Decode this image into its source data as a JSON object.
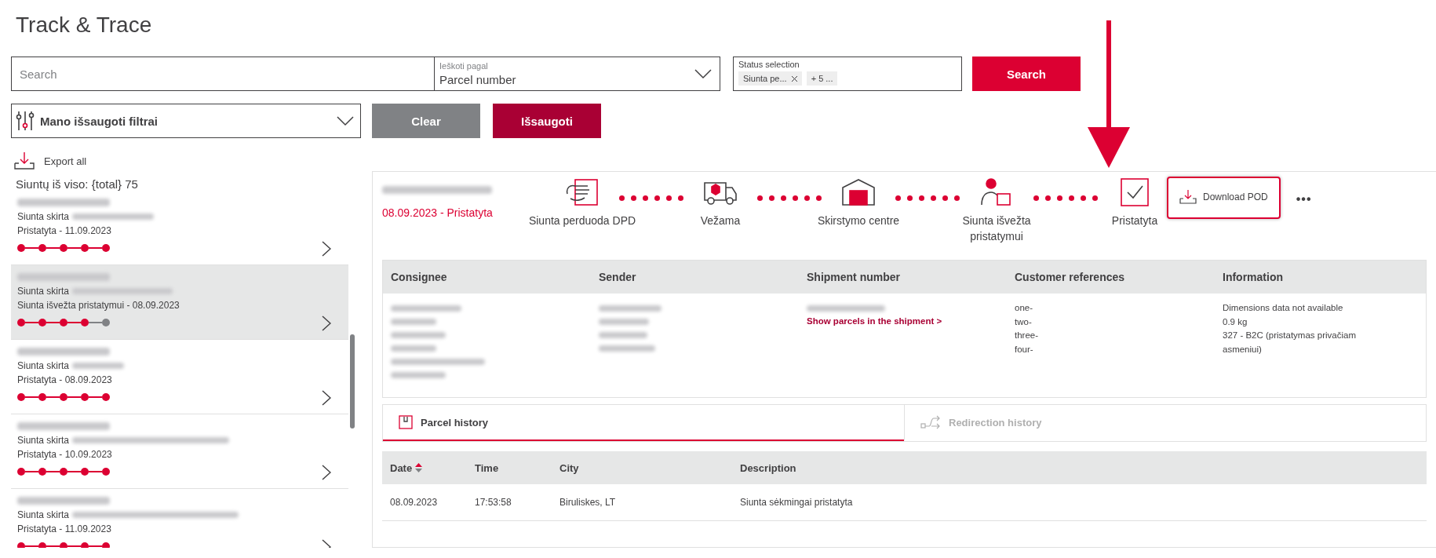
{
  "title": "Track & Trace",
  "search": {
    "placeholder": "Search",
    "search_by": {
      "label": "Ieškoti pagal",
      "value": "Parcel number"
    },
    "status_selection": {
      "label": "Status selection",
      "chips": [
        "Siunta pe...",
        "+ 5 ..."
      ]
    },
    "button": "Search"
  },
  "filters": {
    "saved_filters": "Mano išsaugoti filtrai",
    "clear": "Clear",
    "save": "Išsaugoti"
  },
  "export_all": "Export all",
  "total": "Siuntų iš viso: {total}  75",
  "parcels": [
    {
      "recipient_prefix": "Siunta skirta",
      "status": "Pristatyta - 11.09.2023",
      "selected": false,
      "steps": [
        true,
        true,
        true,
        true,
        true
      ]
    },
    {
      "recipient_prefix": "Siunta skirta",
      "status": "Siunta išvežta pristatymui - 08.09.2023",
      "selected": true,
      "steps": [
        true,
        true,
        true,
        true,
        false
      ]
    },
    {
      "recipient_prefix": "Siunta skirta",
      "status": "Pristatyta - 08.09.2023",
      "selected": false,
      "steps": [
        true,
        true,
        true,
        true,
        true
      ]
    },
    {
      "recipient_prefix": "Siunta skirta",
      "status": "Pristatyta - 10.09.2023",
      "selected": false,
      "steps": [
        true,
        true,
        true,
        true,
        true
      ]
    },
    {
      "recipient_prefix": "Siunta skirta",
      "status": "Pristatyta - 11.09.2023",
      "selected": false,
      "steps": [
        true,
        true,
        true,
        true,
        true
      ]
    }
  ],
  "detail": {
    "status": "08.09.2023 - Pristatyta",
    "timeline": [
      {
        "kind": "handover",
        "label": "Siunta perduoda DPD"
      },
      {
        "kind": "van",
        "label": "Vežama"
      },
      {
        "kind": "depot",
        "label": "Skirstymo centre"
      },
      {
        "kind": "courier",
        "label": "Siunta išvežta pristatymui"
      },
      {
        "kind": "delivered",
        "label": "Pristatyta"
      }
    ],
    "download_pod": "Download POD",
    "more": "•••",
    "info_columns": [
      "Consignee",
      "Sender",
      "Shipment number",
      "Customer references",
      "Information"
    ],
    "shipment_link": "Show parcels in the shipment >",
    "customer_references": [
      "one-",
      "two-",
      "three-",
      "four-"
    ],
    "information": [
      "Dimensions data not available",
      "0.9 kg",
      "327 - B2C (pristatymas privačiam asmeniui)"
    ],
    "tabs": [
      {
        "label": "Parcel history",
        "selected": true
      },
      {
        "label": "Redirection history",
        "selected": false
      }
    ],
    "history": {
      "columns": [
        "Date",
        "Time",
        "City",
        "Description"
      ],
      "rows": [
        [
          "08.09.2023",
          "17:53:58",
          "Biruliskes, LT",
          "Siunta sėkmingai pristatyta"
        ]
      ]
    }
  }
}
